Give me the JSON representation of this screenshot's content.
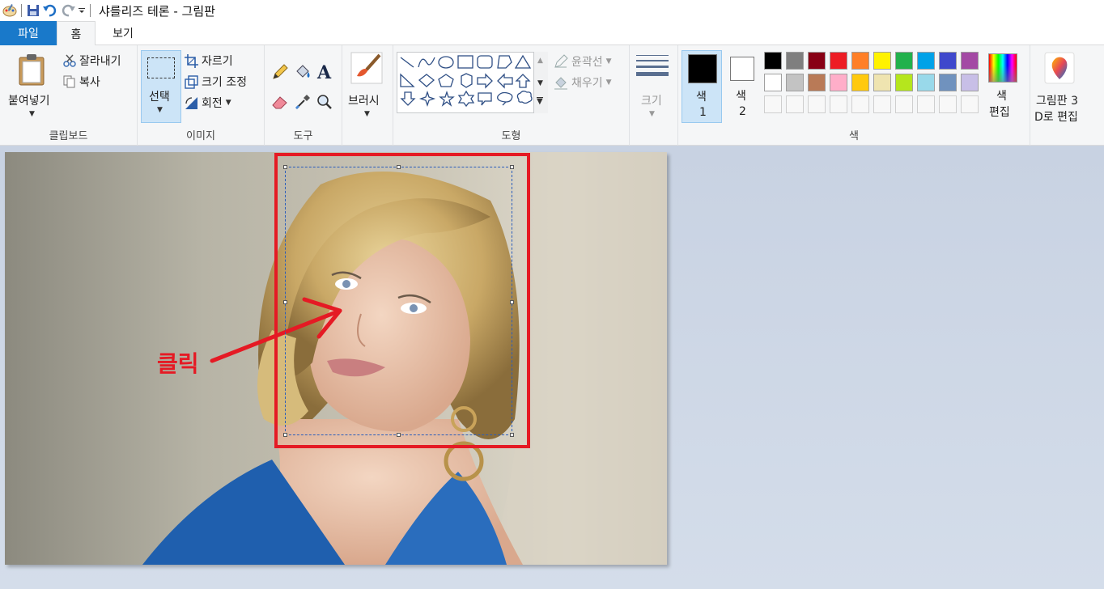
{
  "window": {
    "title": "샤를리즈 테론 - 그림판"
  },
  "tabs": {
    "file": "파일",
    "home": "홈",
    "view": "보기"
  },
  "clipboard": {
    "paste": "붙여넣기",
    "cut": "잘라내기",
    "copy": "복사",
    "label": "클립보드"
  },
  "image": {
    "select": "선택",
    "crop": "자르기",
    "resize": "크기 조정",
    "rotate": "회전",
    "label": "이미지"
  },
  "tools": {
    "label": "도구"
  },
  "brushes": {
    "label": "브러시"
  },
  "shapes": {
    "outline": "윤곽선",
    "fill": "채우기",
    "label": "도형"
  },
  "size": {
    "label": "크기"
  },
  "colors": {
    "color1_label": "색",
    "color1_num": "1",
    "color2_label": "색",
    "color2_num": "2",
    "edit_label1": "색",
    "edit_label2": "편집",
    "label": "색",
    "color1": "#000000",
    "color2": "#ffffff",
    "palette_row1": [
      "#000000",
      "#7f7f7f",
      "#880015",
      "#ed1c24",
      "#ff7f27",
      "#fff200",
      "#22b14c",
      "#00a2e8",
      "#3f48cc",
      "#a349a4"
    ],
    "palette_row2": [
      "#ffffff",
      "#c3c3c3",
      "#b97a57",
      "#ffaec9",
      "#ffc90e",
      "#efe4b0",
      "#b5e61d",
      "#99d9ea",
      "#7092be",
      "#c8bfe7"
    ]
  },
  "paint3d": {
    "line1": "그림판 3",
    "line2": "D로 편집"
  },
  "annotation": {
    "text": "클릭"
  }
}
